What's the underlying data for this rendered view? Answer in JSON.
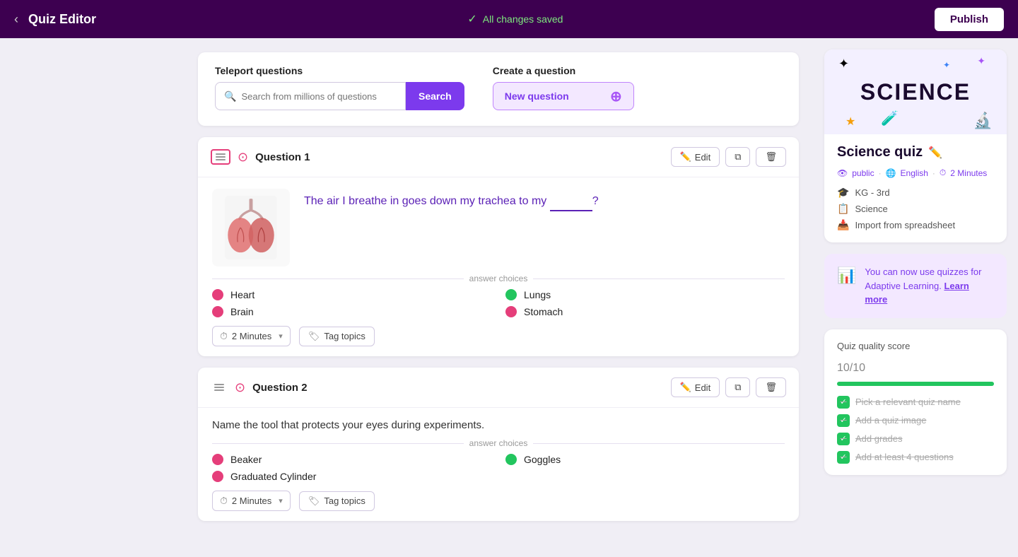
{
  "topbar": {
    "back_icon": "‹",
    "title": "Quiz Editor",
    "saved_text": "All changes saved",
    "publish_label": "Publish"
  },
  "teleport": {
    "label": "Teleport questions",
    "search_placeholder": "Search from millions of questions",
    "search_button": "Search"
  },
  "create": {
    "label": "Create a question",
    "new_button": "New question"
  },
  "questions": [
    {
      "id": "q1",
      "label": "Question 1",
      "text": "The air I breathe in goes down my trachea to my ______?",
      "has_image": true,
      "answer_choices_label": "answer choices",
      "answers": [
        {
          "text": "Heart",
          "correct": false
        },
        {
          "text": "Lungs",
          "correct": true
        },
        {
          "text": "Brain",
          "correct": false
        },
        {
          "text": "Stomach",
          "correct": false
        }
      ],
      "time": "2 Minutes",
      "tag_label": "Tag topics",
      "edit_label": "Edit",
      "delete_label": "Delete"
    },
    {
      "id": "q2",
      "label": "Question 2",
      "text": "Name the tool that protects your eyes during experiments.",
      "has_image": false,
      "answer_choices_label": "answer choices",
      "answers": [
        {
          "text": "Beaker",
          "correct": false
        },
        {
          "text": "Goggles",
          "correct": true
        },
        {
          "text": "Graduated Cylinder",
          "correct": false
        }
      ],
      "time": "2 Minutes",
      "tag_label": "Tag topics",
      "edit_label": "Edit",
      "delete_label": "Delete"
    }
  ],
  "quiz_info": {
    "title": "Science quiz",
    "banner_text": "SCIENCE",
    "visibility": "public",
    "language_icon": "🌐",
    "language": "English",
    "time_icon": "⏱",
    "duration": "2 Minutes",
    "grade": "KG - 3rd",
    "subject": "Science",
    "import_label": "Import from spreadsheet"
  },
  "adaptive": {
    "text": "You can now use quizzes for Adaptive Learning.",
    "link_text": "Learn more"
  },
  "quality": {
    "label": "Quiz quality score",
    "score": "10",
    "out_of": "/10",
    "bar_pct": 100,
    "checklist": [
      "Pick a relevant quiz name",
      "Add a quiz image",
      "Add grades",
      "Add at least 4 questions"
    ]
  }
}
